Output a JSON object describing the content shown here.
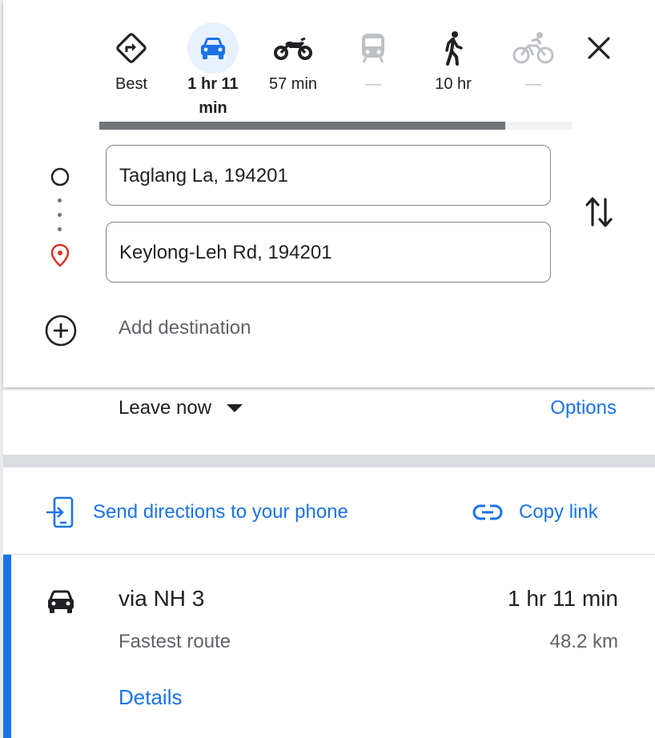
{
  "travel_modes": [
    {
      "key": "best",
      "icon": "directions-icon",
      "label": "Best"
    },
    {
      "key": "driving",
      "icon": "car-icon",
      "label": "1 hr 11\nmin",
      "selected": true
    },
    {
      "key": "motorcycle",
      "icon": "motorcycle-icon",
      "label": "57 min"
    },
    {
      "key": "transit",
      "icon": "train-icon",
      "label": "—"
    },
    {
      "key": "walking",
      "icon": "walk-icon",
      "label": "10 hr"
    },
    {
      "key": "cycling",
      "icon": "bicycle-icon",
      "label": "—"
    }
  ],
  "progress": 0.86,
  "origin": {
    "value": "Taglang La, 194201"
  },
  "destination": {
    "value": "Keylong-Leh Rd, 194201"
  },
  "add_destination_label": "Add destination",
  "depart": {
    "label": "Leave now"
  },
  "options_label": "Options",
  "send_directions_label": "Send directions to your phone",
  "copy_link_label": "Copy link",
  "route": {
    "title": "via NH 3",
    "duration": "1 hr 11 min",
    "subtitle": "Fastest route",
    "distance": "48.2 km",
    "details_label": "Details"
  },
  "colors": {
    "accent": "#1a73e8",
    "selected_bg": "#e8f0fe",
    "destination_pin": "#d93025"
  }
}
